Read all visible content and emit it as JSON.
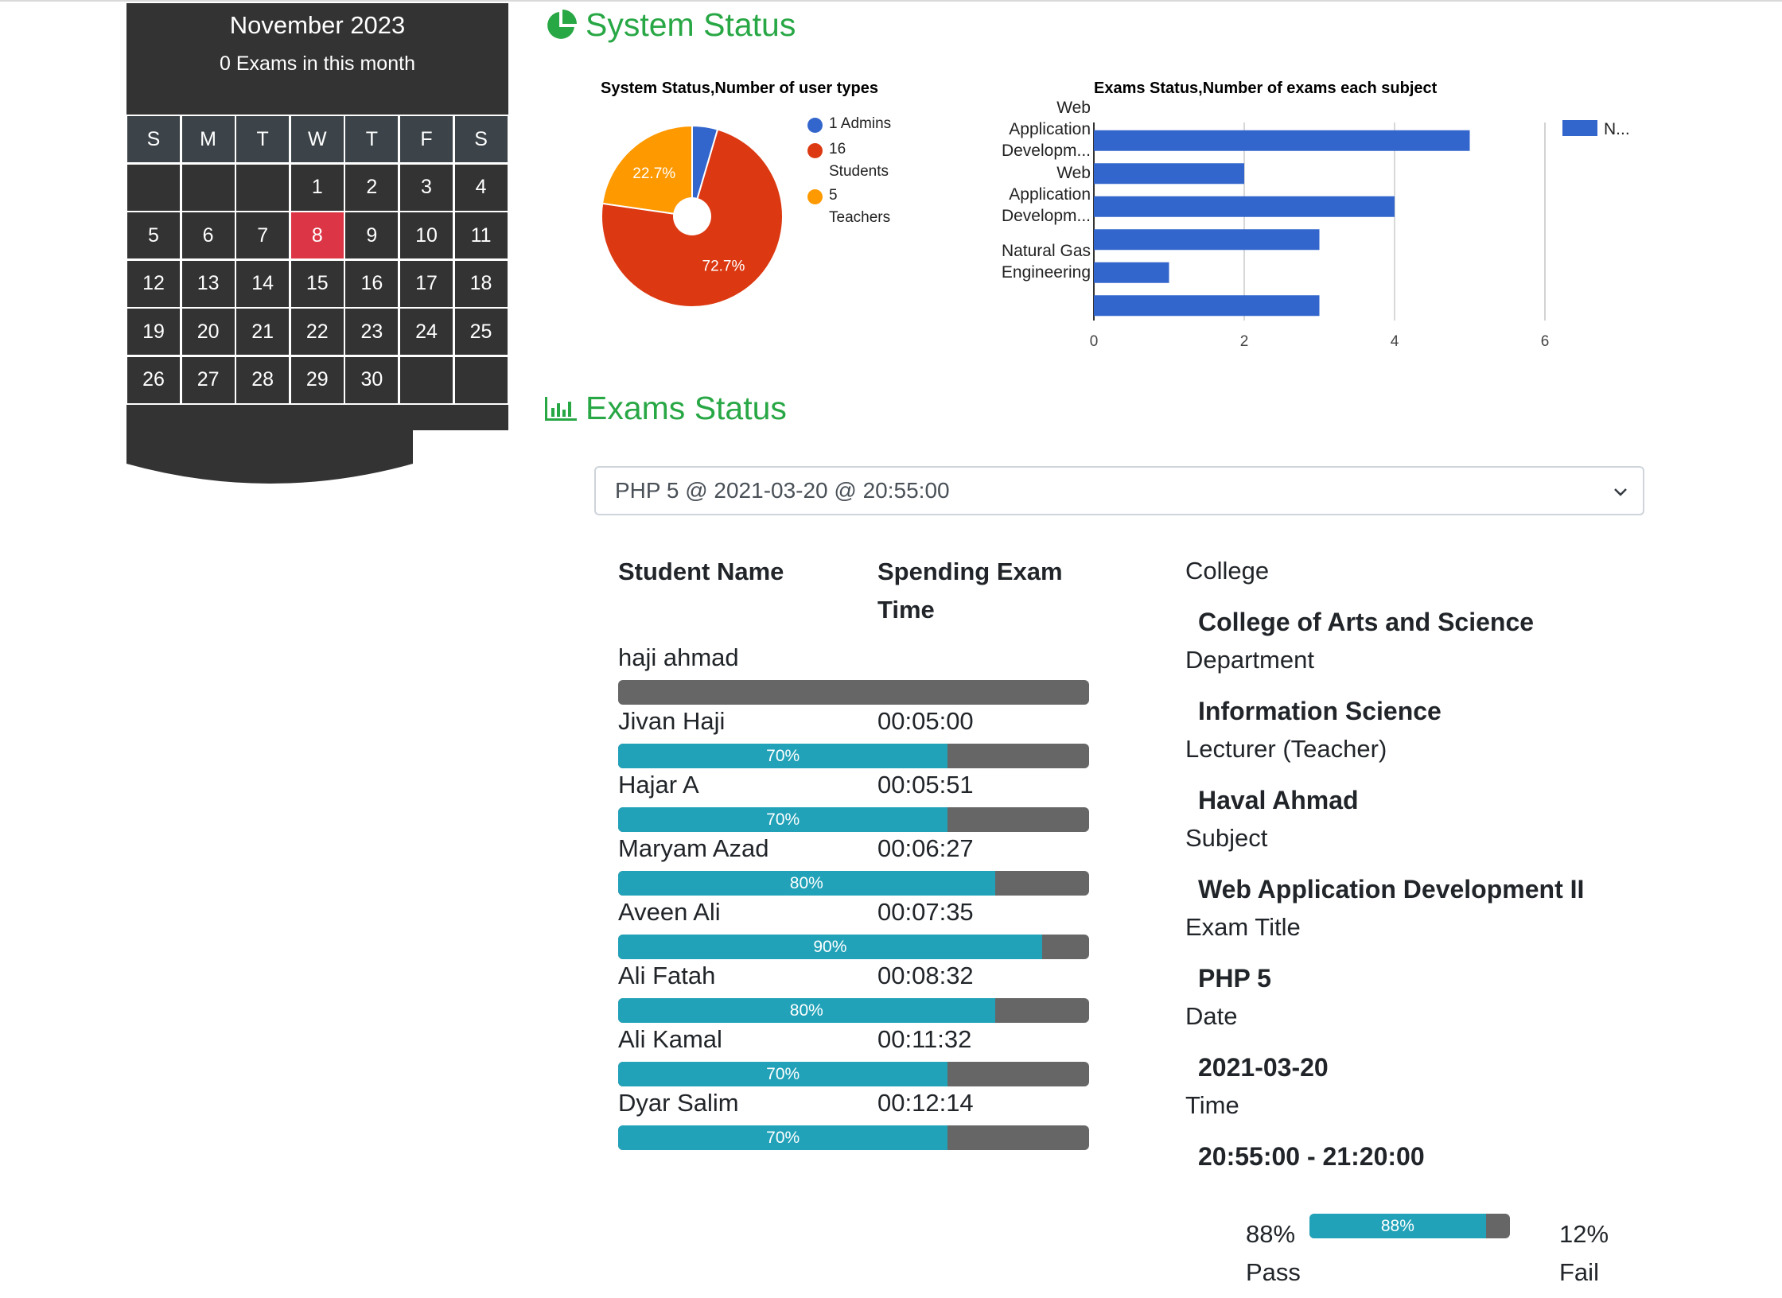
{
  "calendar": {
    "month_title": "November 2023",
    "exams_count_text": "0 Exams in this month",
    "weekdays": [
      "S",
      "M",
      "T",
      "W",
      "T",
      "F",
      "S"
    ],
    "days": [
      "",
      "",
      "",
      "1",
      "2",
      "3",
      "4",
      "5",
      "6",
      "7",
      "8",
      "9",
      "10",
      "11",
      "12",
      "13",
      "14",
      "15",
      "16",
      "17",
      "18",
      "19",
      "20",
      "21",
      "22",
      "23",
      "24",
      "25",
      "26",
      "27",
      "28",
      "29",
      "30",
      "",
      ""
    ],
    "today": "8",
    "colors": {
      "cell": "#333333",
      "today": "#dc3545"
    }
  },
  "system_status": {
    "heading": "System Status",
    "icon": "pie-chart-icon"
  },
  "exams_status": {
    "heading": "Exams Status",
    "icon": "bar-chart-icon"
  },
  "chart_data": [
    {
      "type": "pie",
      "title": "System Status,Number of user types",
      "labels": [
        "1 Admins",
        "16 Students",
        "5 Teachers"
      ],
      "legend_lines": [
        [
          "1 Admins"
        ],
        [
          "16",
          "Students"
        ],
        [
          "5",
          "Teachers"
        ]
      ],
      "values": [
        1,
        16,
        5
      ],
      "slice_labels": [
        "",
        "72.7%",
        "22.7%"
      ],
      "colors": [
        "#3366cc",
        "#dc3912",
        "#ff9900"
      ],
      "donut_hole": true,
      "legend": "right"
    },
    {
      "type": "bar",
      "orientation": "horizontal",
      "title": "Exams Status,Number of exams each subject",
      "category_label_lines": [
        [
          "Web",
          "Application",
          "Developm..."
        ],
        [
          "Web",
          "Application",
          "Developm..."
        ],
        [
          "Natural Gas",
          "Engineering"
        ]
      ],
      "values": [
        5,
        2,
        4,
        3,
        1,
        3
      ],
      "xlim": [
        0,
        6
      ],
      "xticks": [
        "0",
        "2",
        "4",
        "6"
      ],
      "series": [
        {
          "name": "N...",
          "values": [
            5,
            2,
            4,
            3,
            1,
            3
          ]
        }
      ],
      "color": "#3366cc",
      "grid": true,
      "legend": "right"
    }
  ],
  "exam_select": {
    "value": "PHP 5 @ 2021-03-20 @ 20:55:00"
  },
  "students_table": {
    "headers": {
      "name": "Student Name",
      "time_line1": "Spending Exam",
      "time_line2": "Time"
    },
    "rows": [
      {
        "name": "haji ahmad",
        "time": "",
        "score": 0,
        "label": ""
      },
      {
        "name": "Jivan Haji",
        "time": "00:05:00",
        "score": 70,
        "label": "70%"
      },
      {
        "name": "Hajar A",
        "time": "00:05:51",
        "score": 70,
        "label": "70%"
      },
      {
        "name": "Maryam Azad",
        "time": "00:06:27",
        "score": 80,
        "label": "80%"
      },
      {
        "name": "Aveen Ali",
        "time": "00:07:35",
        "score": 90,
        "label": "90%"
      },
      {
        "name": "Ali Fatah",
        "time": "00:08:32",
        "score": 80,
        "label": "80%"
      },
      {
        "name": "Ali Kamal",
        "time": "00:11:32",
        "score": 70,
        "label": "70%"
      },
      {
        "name": "Dyar Salim",
        "time": "00:12:14",
        "score": 70,
        "label": "70%"
      }
    ],
    "colors": {
      "fill": "#22a2b8",
      "track": "#666666"
    }
  },
  "exam_info": {
    "college_label": "College",
    "college_value": "College of Arts and Science",
    "department_label": "Department",
    "department_value": "Information Science",
    "lecturer_label": "Lecturer (Teacher)",
    "lecturer_value": "Haval Ahmad",
    "subject_label": "Subject",
    "subject_value": "Web Application Development II",
    "exam_title_label": "Exam Title",
    "exam_title_value": "PHP 5",
    "date_label": "Date",
    "date_value": "2021-03-20",
    "time_label": "Time",
    "time_value": "20:55:00 - 21:20:00"
  },
  "pass_fail": {
    "pass_percent": "88%",
    "pass_label": "Pass",
    "fail_percent": "12%",
    "fail_label": "Fail",
    "bar_label": "88%",
    "pass_value": 88
  }
}
